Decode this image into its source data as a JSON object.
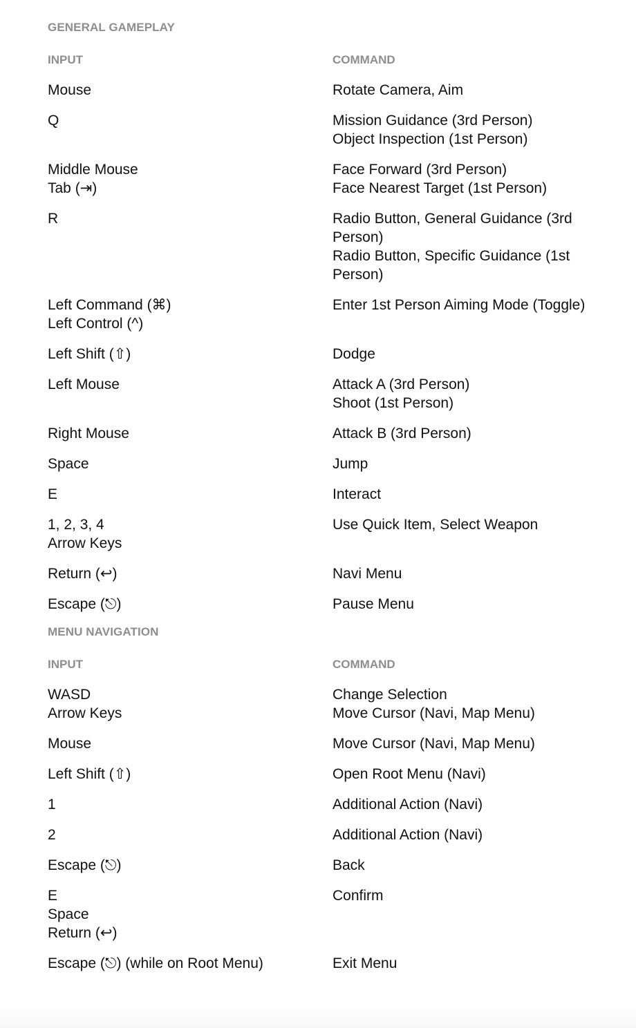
{
  "sections": [
    {
      "title": "GENERAL GAMEPLAY",
      "input_header": "INPUT",
      "command_header": "COMMAND",
      "rows": [
        {
          "input": [
            "Mouse"
          ],
          "command": [
            "Rotate Camera, Aim"
          ]
        },
        {
          "input": [
            "Q"
          ],
          "command": [
            "Mission Guidance (3rd Person)",
            "Object Inspection (1st Person)"
          ]
        },
        {
          "input": [
            "Middle Mouse",
            "Tab (⇥)"
          ],
          "command": [
            "Face Forward (3rd Person)",
            "Face Nearest Target (1st Person)"
          ]
        },
        {
          "input": [
            "R"
          ],
          "command": [
            "Radio Button, General Guidance (3rd Person)",
            "Radio Button, Specific Guidance (1st Person)"
          ]
        },
        {
          "input": [
            "Left Command (⌘)",
            "Left Control (^)"
          ],
          "command": [
            "Enter 1st Person Aiming Mode (Toggle)"
          ]
        },
        {
          "input": [
            "Left Shift (⇧)"
          ],
          "command": [
            "Dodge"
          ]
        },
        {
          "input": [
            "Left Mouse"
          ],
          "command": [
            "Attack A (3rd Person)",
            "Shoot (1st Person)"
          ]
        },
        {
          "input": [
            "Right Mouse"
          ],
          "command": [
            "Attack B (3rd Person)"
          ]
        },
        {
          "input": [
            "Space"
          ],
          "command": [
            "Jump"
          ]
        },
        {
          "input": [
            "E"
          ],
          "command": [
            "Interact"
          ]
        },
        {
          "input": [
            "1, 2, 3, 4",
            "Arrow Keys"
          ],
          "command": [
            "Use Quick Item, Select Weapon"
          ]
        },
        {
          "input": [
            "Return (↩)"
          ],
          "command": [
            "Navi Menu"
          ]
        },
        {
          "input": [
            "Escape (⎋)"
          ],
          "command": [
            "Pause Menu"
          ]
        }
      ]
    },
    {
      "title": "MENU NAVIGATION",
      "input_header": "INPUT",
      "command_header": "COMMAND",
      "rows": [
        {
          "input": [
            "WASD",
            "Arrow Keys"
          ],
          "command": [
            "Change Selection",
            "Move Cursor (Navi, Map Menu)"
          ]
        },
        {
          "input": [
            "Mouse"
          ],
          "command": [
            "Move Cursor (Navi, Map Menu)"
          ]
        },
        {
          "input": [
            "Left Shift (⇧)"
          ],
          "command": [
            "Open Root Menu (Navi)"
          ]
        },
        {
          "input": [
            "1"
          ],
          "command": [
            "Additional Action (Navi)"
          ]
        },
        {
          "input": [
            "2"
          ],
          "command": [
            "Additional Action (Navi)"
          ]
        },
        {
          "input": [
            "Escape (⎋)"
          ],
          "command": [
            "Back"
          ]
        },
        {
          "input": [
            "E",
            "Space",
            "Return (↩)"
          ],
          "command": [
            "Confirm"
          ]
        },
        {
          "input": [
            "Escape (⎋) (while on Root Menu)"
          ],
          "command": [
            "Exit Menu"
          ]
        }
      ]
    }
  ]
}
